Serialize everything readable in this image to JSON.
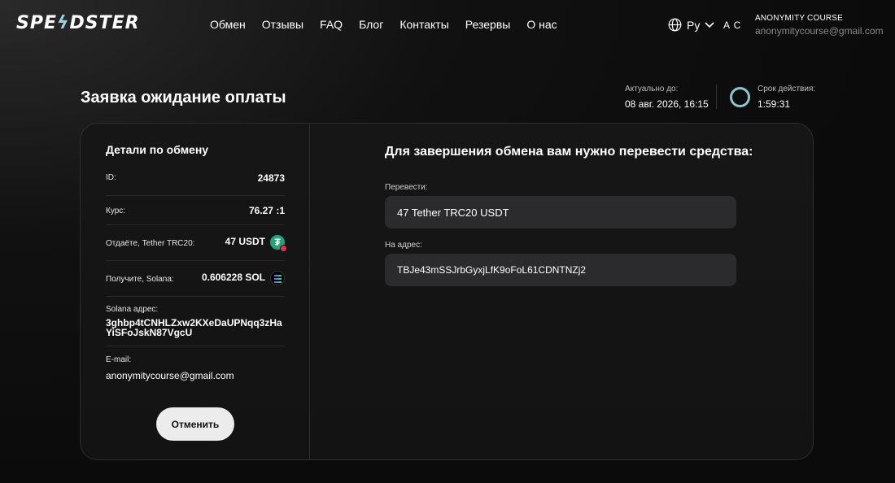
{
  "header": {
    "logo_left": "SPE",
    "logo_bolt": "ϟ",
    "logo_right": "DSTER",
    "nav": [
      "Обмен",
      "Отзывы",
      "FAQ",
      "Блог",
      "Контакты",
      "Резервы",
      "О нас"
    ],
    "language": "Ру",
    "avatar_initials": "A C",
    "user_name": "ANONYMITY COURSE",
    "user_email": "anonymitycourse@gmail.com"
  },
  "title": "Заявка ожидание оплаты",
  "valid_until": {
    "label": "Актуально до:",
    "value": "08 авг. 2026, 16:15"
  },
  "term": {
    "label": "Срок действия:",
    "value": "1:59:31"
  },
  "details": {
    "heading": "Детали по обмену",
    "id_label": "ID:",
    "id_value": "24873",
    "rate_label": "Курс:",
    "rate_value": "76.27 :1",
    "give_label": "Отдаёте, Tether TRC20:",
    "give_value": "47 USDT",
    "receive_label": "Получите, Solana:",
    "receive_value": "0.606228 SOL",
    "address_label": "Solana адрес:",
    "address_value": "3ghbp4tCNHLZxw2KXeDaUPNqq3zHaYiSFoJskN87VgcU",
    "email_label": "E-mail:",
    "email_value": "anonymitycourse@gmail.com",
    "cancel_label": "Отменить"
  },
  "payment": {
    "heading": "Для завершения обмена вам нужно перевести средства:",
    "amount_label": "Перевести:",
    "amount_value": "47 Tether TRC20 USDT",
    "address_label": "На адрес:",
    "address_value": "TBJe43mSSJrbGyxjLfK9oFoL61CDNTNZj2"
  },
  "icons": {
    "globe": "globe-icon",
    "chevron": "chevron-down-icon",
    "usdt": "tether-icon",
    "sol": "solana-icon"
  },
  "colors": {
    "accent": "#8fc3cf",
    "usdt": "#26a17b"
  }
}
